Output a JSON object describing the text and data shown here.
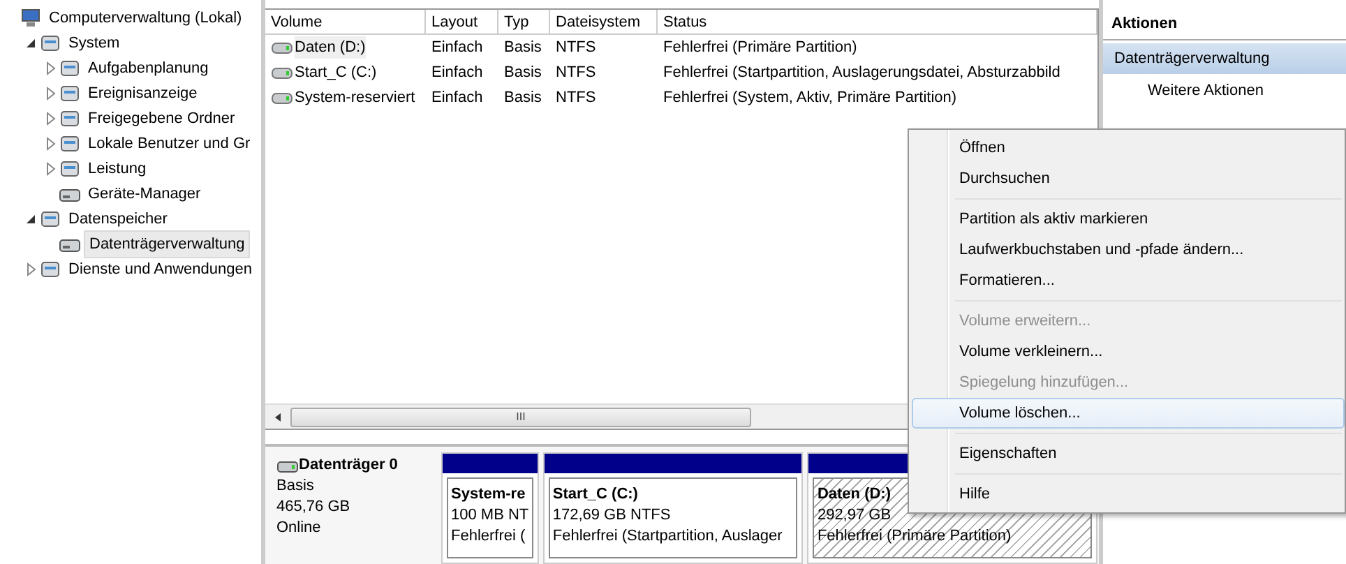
{
  "tree": [
    {
      "label": "Computerverwaltung (Lokal)",
      "kind": "root",
      "selected": false,
      "children": [
        {
          "label": "System",
          "kind": "branch",
          "expanded": true,
          "selected": false,
          "children": [
            {
              "label": "Aufgabenplanung",
              "kind": "branch",
              "expanded": false,
              "selected": false
            },
            {
              "label": "Ereignisanzeige",
              "kind": "branch",
              "expanded": false,
              "selected": false
            },
            {
              "label": "Freigegebene Ordner",
              "kind": "branch",
              "expanded": false,
              "selected": false
            },
            {
              "label": "Lokale Benutzer und Gr",
              "kind": "branch",
              "expanded": false,
              "selected": false
            },
            {
              "label": "Leistung",
              "kind": "branch",
              "expanded": false,
              "selected": false
            },
            {
              "label": "Geräte-Manager",
              "kind": "leaf",
              "selected": false
            }
          ]
        },
        {
          "label": "Datenspeicher",
          "kind": "branch",
          "expanded": true,
          "selected": false,
          "children": [
            {
              "label": "Datenträgerverwaltung",
              "kind": "leaf",
              "selected": true
            }
          ]
        },
        {
          "label": "Dienste und Anwendungen",
          "kind": "branch",
          "expanded": false,
          "selected": false
        }
      ]
    }
  ],
  "table": {
    "columns": [
      "Volume",
      "Layout",
      "Typ",
      "Dateisystem",
      "Status"
    ],
    "rows": [
      {
        "cells": [
          "Daten (D:)",
          "Einfach",
          "Basis",
          "NTFS",
          "Fehlerfrei (Primäre Partition)"
        ],
        "selected": true
      },
      {
        "cells": [
          "Start_C (C:)",
          "Einfach",
          "Basis",
          "NTFS",
          "Fehlerfrei (Startpartition, Auslagerungsdatei, Absturzabbild"
        ],
        "selected": false
      },
      {
        "cells": [
          "System-reserviert",
          "Einfach",
          "Basis",
          "NTFS",
          "Fehlerfrei (System, Aktiv, Primäre Partition)"
        ],
        "selected": false
      }
    ]
  },
  "scrollbar_grip": "III",
  "disk": {
    "name": "Datenträger 0",
    "type": "Basis",
    "size": "465,76 GB",
    "state": "Online",
    "partitions": [
      {
        "name": "System-re",
        "size": "100 MB NT",
        "status": "Fehlerfrei (",
        "selected": false
      },
      {
        "name": "Start_C  (C:)",
        "size": "172,69 GB NTFS",
        "status": "Fehlerfrei (Startpartition, Auslager",
        "selected": false
      },
      {
        "name": "Daten  (D:)",
        "size": "292,97 GB",
        "status": "Fehlerfrei (Primäre Partition)",
        "selected": true
      }
    ]
  },
  "actions": {
    "title": "Aktionen",
    "section": "Datenträgerverwaltung",
    "items": [
      "Weitere Aktionen"
    ]
  },
  "context_menu": [
    {
      "kind": "item",
      "label": "Öffnen",
      "disabled": false,
      "selected": false
    },
    {
      "kind": "item",
      "label": "Durchsuchen",
      "disabled": false,
      "selected": false
    },
    {
      "kind": "separator"
    },
    {
      "kind": "item",
      "label": "Partition als aktiv markieren",
      "disabled": false,
      "selected": false
    },
    {
      "kind": "item",
      "label": "Laufwerkbuchstaben und -pfade ändern...",
      "disabled": false,
      "selected": false
    },
    {
      "kind": "item",
      "label": "Formatieren...",
      "disabled": false,
      "selected": false
    },
    {
      "kind": "separator"
    },
    {
      "kind": "item",
      "label": "Volume erweitern...",
      "disabled": true,
      "selected": false
    },
    {
      "kind": "item",
      "label": "Volume verkleinern...",
      "disabled": false,
      "selected": false
    },
    {
      "kind": "item",
      "label": "Spiegelung hinzufügen...",
      "disabled": true,
      "selected": false
    },
    {
      "kind": "item",
      "label": "Volume löschen...",
      "disabled": false,
      "selected": true
    },
    {
      "kind": "separator"
    },
    {
      "kind": "item",
      "label": "Eigenschaften",
      "disabled": false,
      "selected": false
    },
    {
      "kind": "separator"
    },
    {
      "kind": "item",
      "label": "Hilfe",
      "disabled": false,
      "selected": false
    }
  ]
}
